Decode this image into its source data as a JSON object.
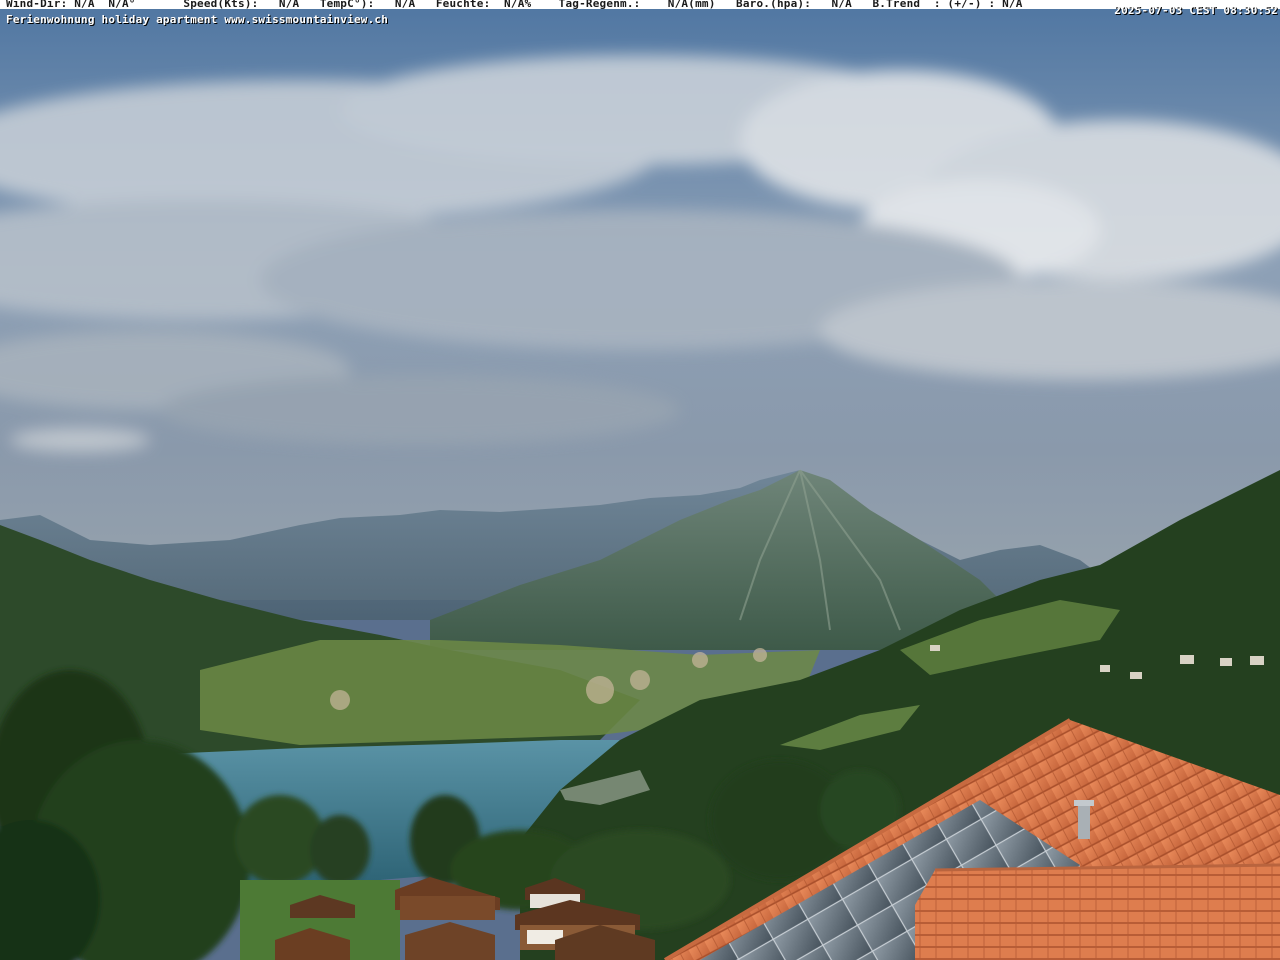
{
  "overlay": {
    "weather_line": "Wind-Dir: N/A  N/A°       Speed(Kts):   N/A   TempC°):   N/A   Feuchte:  N/A%    Tag-Regenm.:    N/A(mm)   Baro.(hpa):   N/A   B.Trend  : (+/-) : N/A",
    "timestamp": "2025-07-03 CEST 08:30:52",
    "caption": "Ferienwohnung holiday apartment www.swissmountainview.ch"
  },
  "scene": {
    "description_icon": "webcam-landscape-icon",
    "colors": {
      "sky_top": "#5b7fa8",
      "sky_bottom": "#8fa2b8",
      "cloud": "#d9dde2",
      "lake": "#4a7f93",
      "roof_tile": "#d9774a",
      "solar_panel": "#6e7d88",
      "forest": "#1f3a1c",
      "meadow": "#6d8a45"
    }
  }
}
